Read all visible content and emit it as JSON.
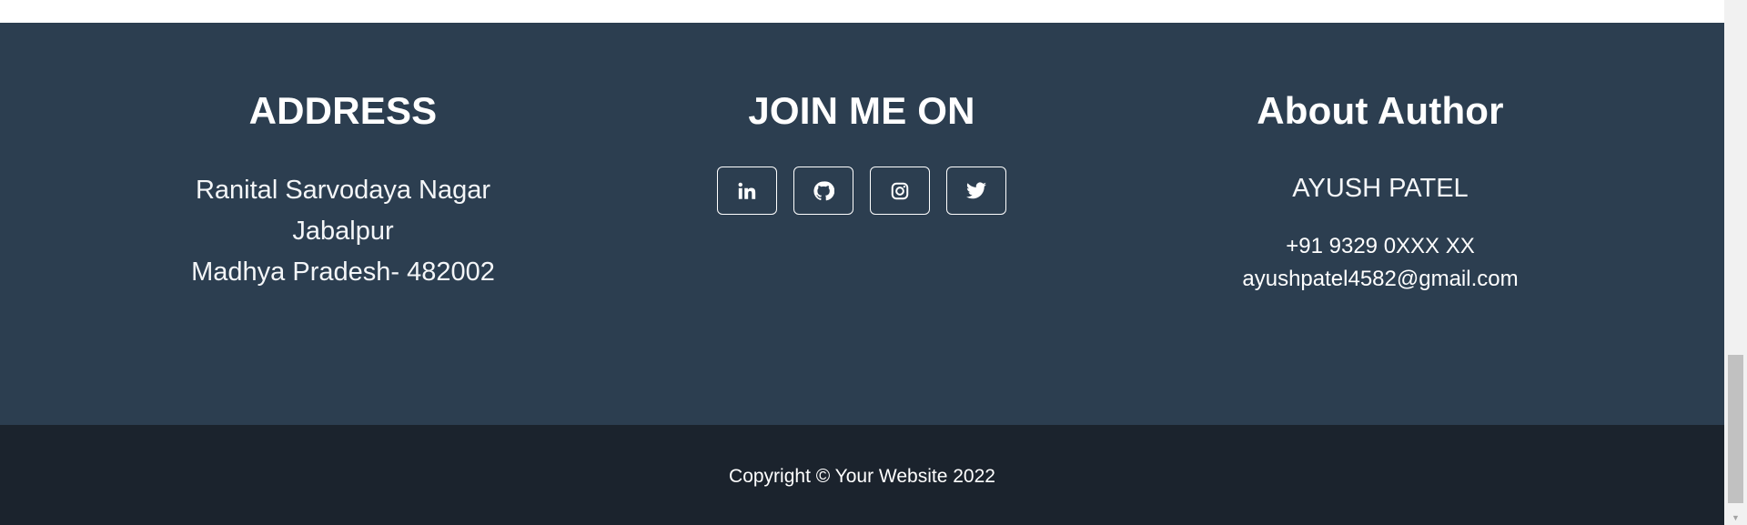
{
  "address": {
    "heading": "ADDRESS",
    "lines": [
      "Ranital Sarvodaya Nagar",
      "Jabalpur",
      "Madhya Pradesh- 482002"
    ]
  },
  "social": {
    "heading": "JOIN ME ON",
    "links": [
      {
        "icon": "linkedin-icon"
      },
      {
        "icon": "github-icon"
      },
      {
        "icon": "instagram-icon"
      },
      {
        "icon": "twitter-icon"
      }
    ]
  },
  "author": {
    "heading": "About Author",
    "name": "AYUSH PATEL",
    "phone": "+91 9329 0XXX XX",
    "email": "ayushpatel4582@gmail.com"
  },
  "footer": {
    "copyright": "Copyright © Your Website 2022"
  },
  "colors": {
    "footer_main_bg": "#2c3e50",
    "footer_bottom_bg": "#1b232d",
    "text": "#ffffff"
  }
}
